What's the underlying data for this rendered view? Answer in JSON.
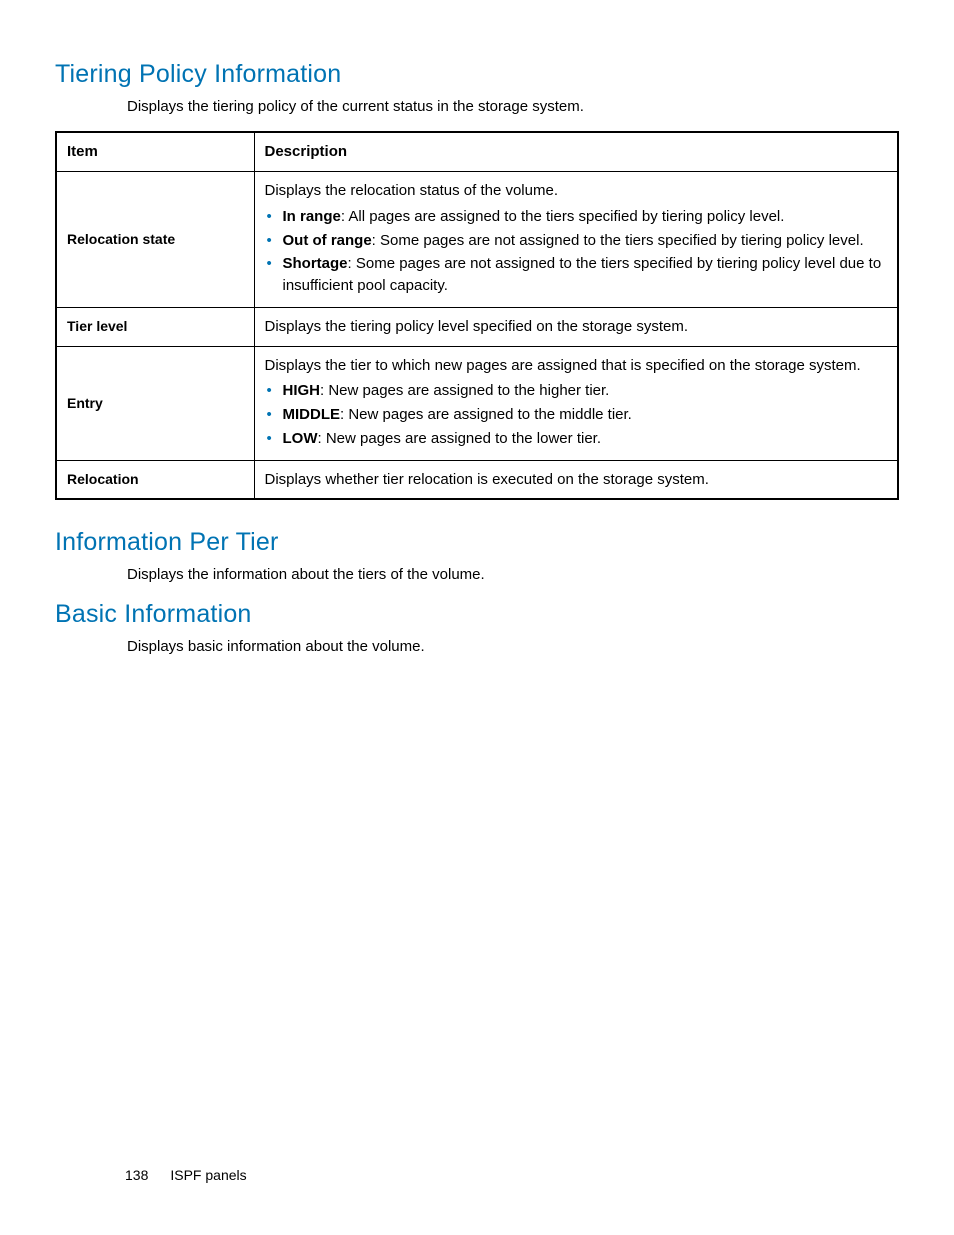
{
  "sections": {
    "tiering": {
      "heading": "Tiering Policy Information",
      "intro": "Displays the tiering policy of the current status in the storage system."
    },
    "per_tier": {
      "heading": "Information Per Tier",
      "intro": "Displays the information about the tiers of the volume."
    },
    "basic": {
      "heading": "Basic Information",
      "intro": "Displays basic information about the volume."
    }
  },
  "table": {
    "header_item": "Item",
    "header_desc": "Description",
    "rows": {
      "relocation_state": {
        "item": "Relocation state",
        "lead": "Displays the relocation status of the volume.",
        "bullets": {
          "in_range": {
            "label": "In range",
            "text": ": All pages are assigned to the tiers specified by tiering policy level."
          },
          "out_range": {
            "label": "Out of range",
            "text": ": Some pages are not assigned to the tiers specified by tiering policy level."
          },
          "shortage": {
            "label": "Shortage",
            "text": ": Some pages are not assigned to the tiers specified by tiering policy level due to insufficient pool capacity."
          }
        }
      },
      "tier_level": {
        "item": "Tier level",
        "desc": "Displays the tiering policy level specified on the storage system."
      },
      "entry": {
        "item": "Entry",
        "lead": "Displays the tier to which new pages are assigned that is specified on the storage system.",
        "bullets": {
          "high": {
            "label": "HIGH",
            "text": ": New pages are assigned to the higher tier."
          },
          "middle": {
            "label": "MIDDLE",
            "text": ": New pages are assigned to the middle tier."
          },
          "low": {
            "label": "LOW",
            "text": ": New pages are assigned to the lower tier."
          }
        }
      },
      "relocation": {
        "item": "Relocation",
        "desc": "Displays whether tier relocation is executed on the storage system."
      }
    }
  },
  "footer": {
    "page_number": "138",
    "chapter": "ISPF panels"
  }
}
